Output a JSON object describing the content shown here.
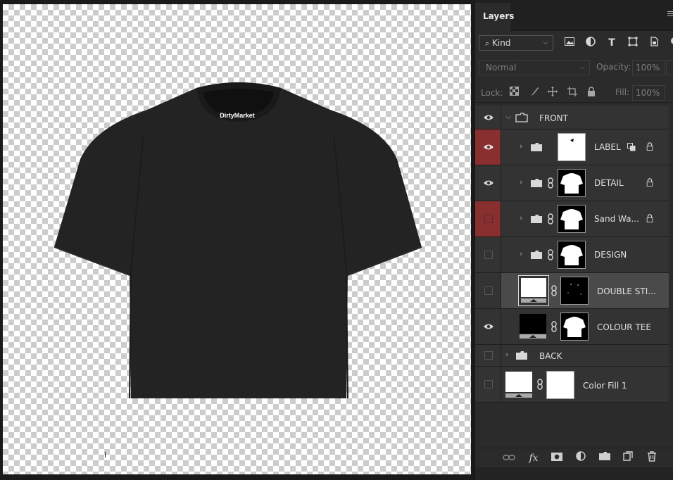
{
  "canvas": {
    "tshirt_label_text": "DirtyMarket",
    "tshirt_color": "#232323"
  },
  "panel": {
    "tab_title": "Layers",
    "filter": {
      "kind_label": "Kind",
      "icons": [
        "image-filter-icon",
        "adjustment-filter-icon",
        "type-filter-icon",
        "shape-filter-icon",
        "smart-object-filter-icon"
      ]
    },
    "blend_mode": "Normal",
    "opacity_label": "Opacity:",
    "opacity_value": "100%",
    "lock_label": "Lock:",
    "fill_label": "Fill:",
    "fill_value": "100%",
    "layers": [
      {
        "name": "FRONT",
        "type": "group",
        "visible": true,
        "expanded": true,
        "indent": 0
      },
      {
        "name": "LABEL",
        "type": "group",
        "visible": true,
        "highlight": true,
        "indent": 1,
        "mask": "label"
      },
      {
        "name": "DETAIL",
        "type": "group",
        "visible": true,
        "indent": 1,
        "mask": "shirt"
      },
      {
        "name": "Sand Wa...",
        "type": "group",
        "visible": false,
        "highlight": true,
        "indent": 1,
        "mask": "shirt"
      },
      {
        "name": "DESIGN",
        "type": "group",
        "visible": false,
        "indent": 1,
        "mask": "shirt"
      },
      {
        "name": "DOUBLE STI...",
        "type": "fill",
        "visible": false,
        "selected": true,
        "indent": 1,
        "mask": "dark"
      },
      {
        "name": "COLOUR TEE",
        "type": "fill",
        "visible": true,
        "indent": 1,
        "mask": "shirt"
      },
      {
        "name": "BACK",
        "type": "group",
        "visible": false,
        "indent": 0
      },
      {
        "name": "Color Fill 1",
        "type": "fill",
        "visible": false,
        "indent": 0
      }
    ],
    "bottom_icons": [
      "link-layers-icon",
      "fx-icon",
      "add-mask-icon",
      "adjustment-layer-icon",
      "new-group-icon",
      "new-layer-icon",
      "delete-icon"
    ],
    "fx_label": "fx"
  }
}
